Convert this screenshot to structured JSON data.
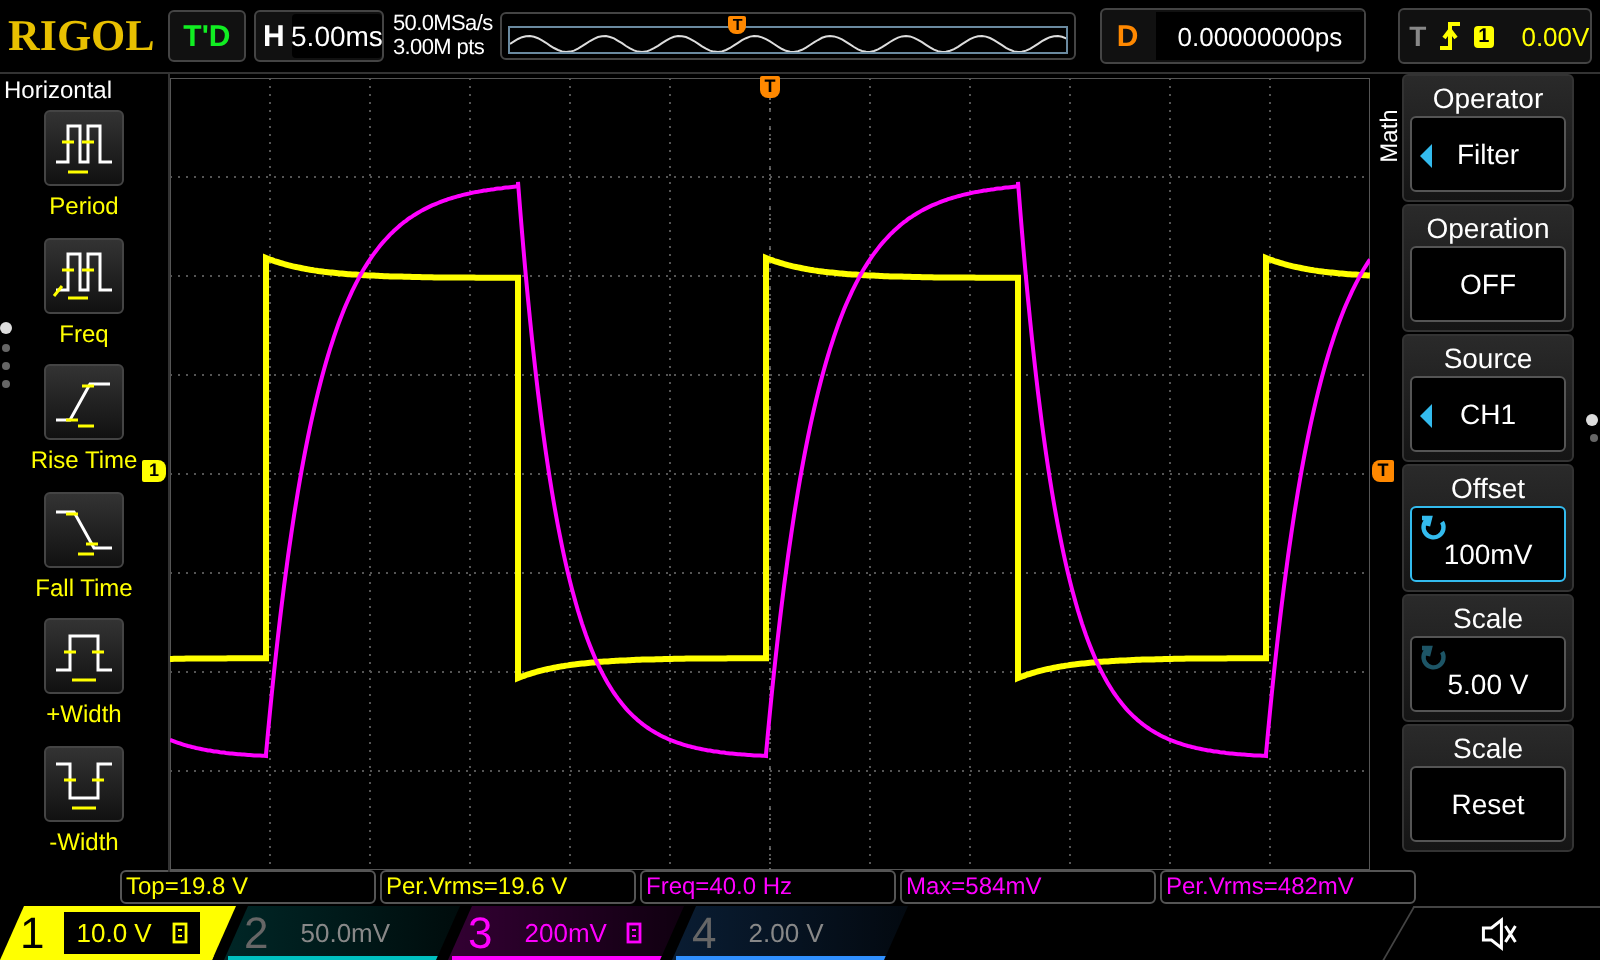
{
  "logo": "RIGOL",
  "run_status": "T'D",
  "timebase": {
    "label": "H",
    "value": "5.00ms"
  },
  "acquisition": {
    "sample_rate": "50.0MSa/s",
    "memory_depth": "3.00M pts"
  },
  "overview": {
    "marker": "T"
  },
  "delay": {
    "label": "D",
    "value": "0.00000000ps"
  },
  "trigger": {
    "label": "T",
    "source": "1",
    "level": "0.00V"
  },
  "left_menu": {
    "title": "Horizontal",
    "items": [
      {
        "label": "Period",
        "kind": "period"
      },
      {
        "label": "Freq",
        "kind": "freq"
      },
      {
        "label": "Rise Time",
        "kind": "rise"
      },
      {
        "label": "Fall Time",
        "kind": "fall"
      },
      {
        "label": "+Width",
        "kind": "pwidth"
      },
      {
        "label": "-Width",
        "kind": "nwidth"
      }
    ],
    "pages": [
      {
        "selected": true
      },
      {
        "selected": false
      },
      {
        "selected": false
      },
      {
        "selected": false
      }
    ]
  },
  "grid_markers": {
    "trigger_top": "T",
    "trigger_right": "T",
    "channel_1": "1"
  },
  "right_menu": {
    "title": "Math",
    "items": [
      {
        "label": "Operator",
        "value": "Filter",
        "kind": "select",
        "selected": false
      },
      {
        "label": "Operation",
        "value": "OFF",
        "kind": "plain",
        "selected": false
      },
      {
        "label": "Source",
        "value": "CH1",
        "kind": "select",
        "selected": false
      },
      {
        "label": "Offset",
        "value": "100mV",
        "kind": "knob",
        "selected": true
      },
      {
        "label": "Scale",
        "value": "5.00 V",
        "kind": "knob",
        "selected": false
      },
      {
        "label": "Scale",
        "value": "Reset",
        "kind": "plain",
        "selected": false
      }
    ],
    "pages": [
      {
        "selected": true
      },
      {
        "selected": false
      }
    ]
  },
  "measurements": [
    {
      "text": "Top=19.8 V",
      "color": "#ffff00"
    },
    {
      "text": "Per.Vrms=19.6 V",
      "color": "#ffff00"
    },
    {
      "text": "Freq=40.0 Hz",
      "color": "#ff00ff"
    },
    {
      "text": "Max=584mV",
      "color": "#ff00ff"
    },
    {
      "text": "Per.Vrms=482mV",
      "color": "#ff00ff"
    }
  ],
  "channels": [
    {
      "number": "1",
      "scale": "10.0 V",
      "on": true,
      "color": "#ffff00"
    },
    {
      "number": "2",
      "scale": "50.0mV",
      "on": false,
      "color": "#00c0c0"
    },
    {
      "number": "3",
      "scale": "200mV",
      "on": true,
      "color": "#ff00ff"
    },
    {
      "number": "4",
      "scale": "2.00 V",
      "on": false,
      "color": "#3090ff"
    }
  ]
}
